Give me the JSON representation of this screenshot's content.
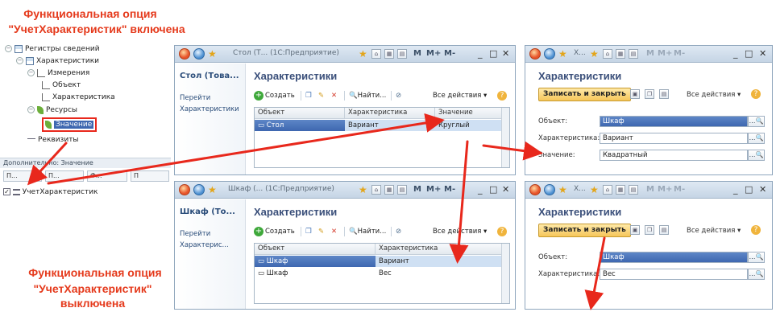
{
  "captions": {
    "top_line1": "Функциональная опция",
    "top_line2": "\"УчетХарактеристик\" включена",
    "bottom_line1": "Функциональная опция",
    "bottom_line2": "\"УчетХарактеристик\" выключена"
  },
  "tree": {
    "registers": "Регистры сведений",
    "characteristics": "Характеристики",
    "dimensions": "Измерения",
    "object": "Объект",
    "characteristic": "Характеристика",
    "resources": "Ресурсы",
    "value": "Значение",
    "requisites": "Реквизиты",
    "additional": "Дополнительно: Значение",
    "tabs": [
      "П...",
      "П...",
      "Ф...",
      "П"
    ],
    "option": "УчетХарактеристик"
  },
  "top_list_window": {
    "title": "Стол (Т...  (1С:Предприятие)",
    "nav_title": "Стол (Това...",
    "nav_goto": "Перейти",
    "nav_link": "Характеристики",
    "form_title": "Характеристики",
    "create": "Создать",
    "find": "Найти...",
    "all_actions": "Все действия ▾",
    "columns": [
      "Объект",
      "Характеристика",
      "Значение"
    ],
    "rows": [
      [
        "Стол",
        "Вариант",
        "Круглый"
      ]
    ]
  },
  "bottom_list_window": {
    "title": "Шкаф (...  (1С:Предприятие)",
    "nav_title": "Шкаф (То...",
    "nav_goto": "Перейти",
    "nav_link": "Характерис...",
    "form_title": "Характеристики",
    "create": "Создать",
    "find": "Найти...",
    "all_actions": "Все действия ▾",
    "columns": [
      "Объект",
      "Характеристика"
    ],
    "rows": [
      [
        "Шкаф",
        "Вариант"
      ],
      [
        "Шкаф",
        "Вес"
      ]
    ]
  },
  "top_record_window": {
    "title": "Х...",
    "form_title": "Характеристики",
    "save_close": "Записать и закрыть",
    "all_actions": "Все действия ▾",
    "object_label": "Объект:",
    "object_value": "Шкаф",
    "char_label": "Характеристика:",
    "char_value": "Вариант",
    "value_label": "Значение:",
    "value_value": "Квадратный"
  },
  "bottom_record_window": {
    "title": "Х...",
    "form_title": "Характеристики",
    "save_close": "Записать и закрыть",
    "all_actions": "Все действия ▾",
    "object_label": "Объект:",
    "object_value": "Шкаф",
    "char_label": "Характеристика:",
    "char_value": "Вес"
  },
  "titlebar_symbols": {
    "m": "M",
    "mplus": "M+",
    "mminus": "M-",
    "minimize": "_",
    "restore": "□",
    "close": "✕",
    "help": "?"
  },
  "colors": {
    "caption_red": "#e53a1c",
    "arrow_red": "#e8281c",
    "selection_blue": "#3e67b0"
  }
}
